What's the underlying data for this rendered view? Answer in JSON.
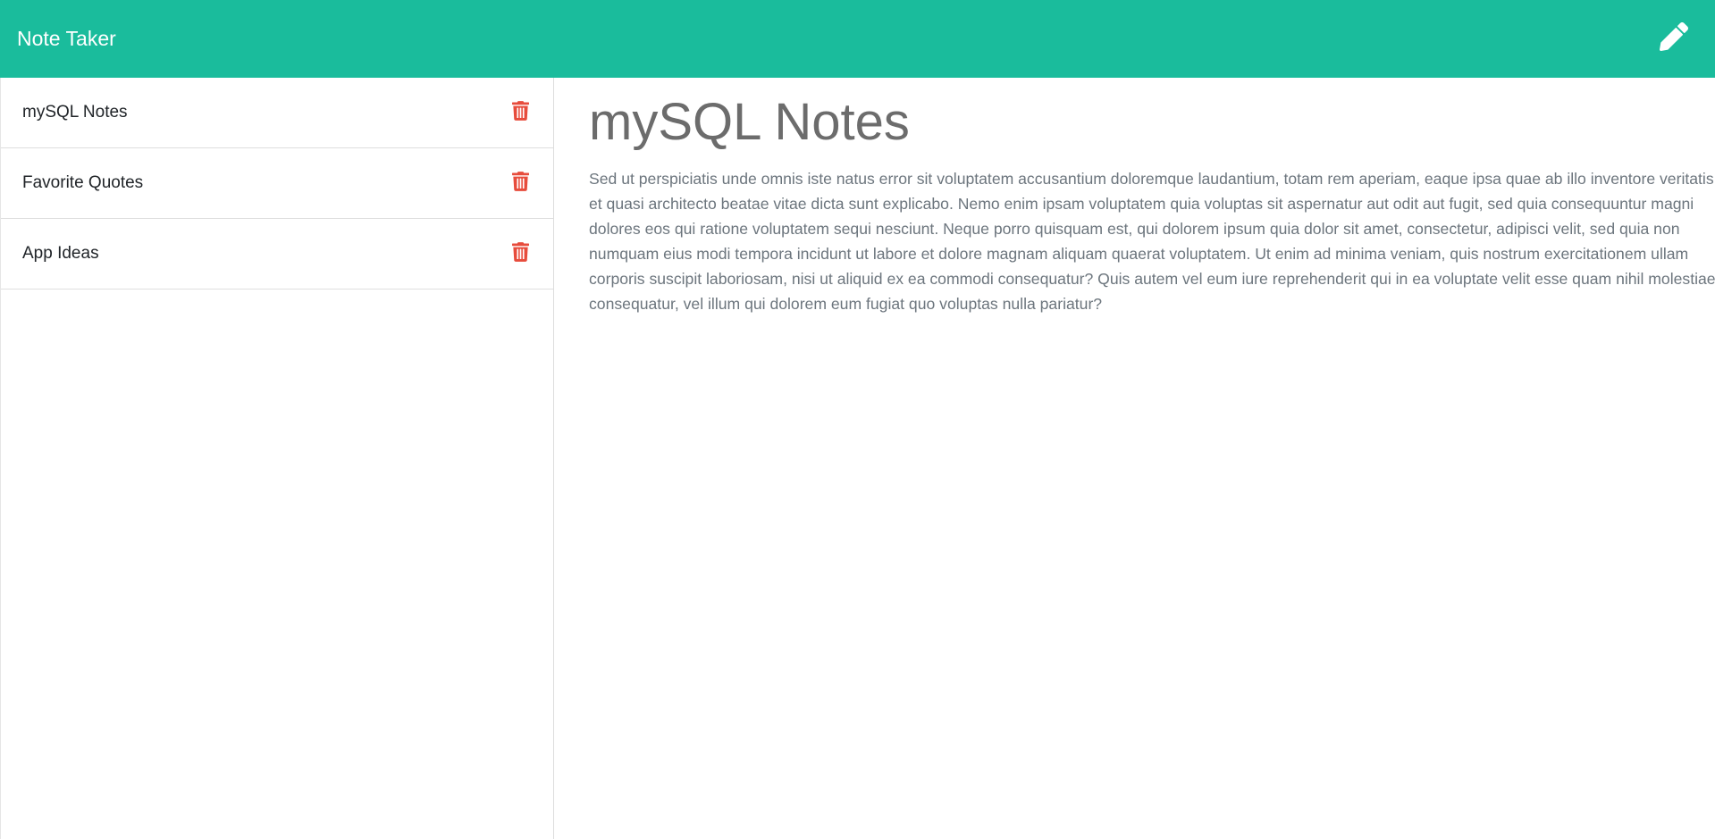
{
  "app": {
    "brand": "Note Taker",
    "accent_color": "#1abc9c",
    "new_note_icon": "pencil-icon"
  },
  "sidebar": {
    "delete_icon": "trash-icon",
    "delete_color": "#e74c3c",
    "notes": [
      {
        "title": "mySQL Notes"
      },
      {
        "title": "Favorite Quotes"
      },
      {
        "title": "App Ideas"
      }
    ]
  },
  "main": {
    "note_title": "mySQL Notes",
    "note_text": "Sed ut perspiciatis unde omnis iste natus error sit voluptatem accusantium doloremque laudantium, totam rem aperiam, eaque ipsa quae ab illo inventore veritatis et quasi architecto beatae vitae dicta sunt explicabo. Nemo enim ipsam voluptatem quia voluptas sit aspernatur aut odit aut fugit, sed quia consequuntur magni dolores eos qui ratione voluptatem sequi nesciunt. Neque porro quisquam est, qui dolorem ipsum quia dolor sit amet, consectetur, adipisci velit, sed quia non numquam eius modi tempora incidunt ut labore et dolore magnam aliquam quaerat voluptatem. Ut enim ad minima veniam, quis nostrum exercitationem ullam corporis suscipit laboriosam, nisi ut aliquid ex ea commodi consequatur? Quis autem vel eum iure reprehenderit qui in ea voluptate velit esse quam nihil molestiae consequatur, vel illum qui dolorem eum fugiat quo voluptas nulla pariatur?"
  }
}
